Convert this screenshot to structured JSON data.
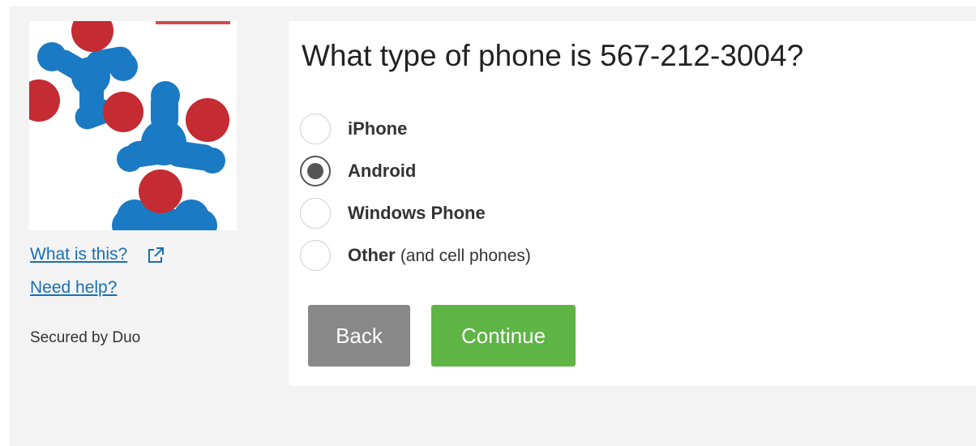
{
  "sidebar": {
    "logo_icon": "duo-org-logo",
    "what_is_this": "What is this?",
    "external_link_icon": "external-link-icon",
    "need_help": "Need help?",
    "secured_by": "Secured by Duo"
  },
  "main": {
    "question": "What type of phone is 567-212-3004?",
    "options": [
      {
        "label": "iPhone",
        "note": "",
        "checked": false
      },
      {
        "label": "Android",
        "note": "",
        "checked": true
      },
      {
        "label": "Windows Phone",
        "note": "",
        "checked": false
      },
      {
        "label": "Other",
        "note": "(and cell phones)",
        "checked": false
      }
    ],
    "back_label": "Back",
    "continue_label": "Continue"
  },
  "colors": {
    "link": "#1a6fb5",
    "continue": "#5eb444",
    "back": "#888888",
    "logo_blue": "#1b7ac4",
    "logo_red": "#c42b33"
  }
}
